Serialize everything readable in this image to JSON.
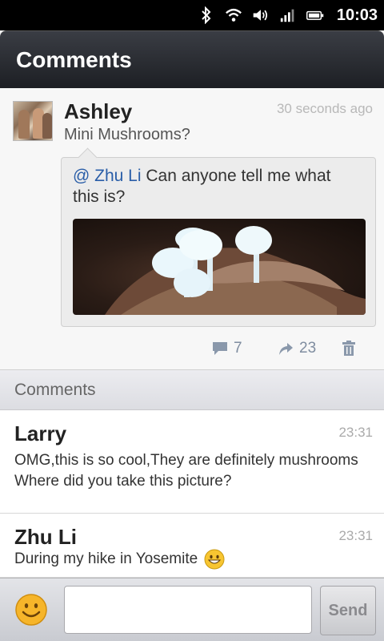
{
  "status_bar": {
    "time": "10:03",
    "icons": [
      "bluetooth-icon",
      "wifi-icon",
      "volume-icon",
      "signal-icon",
      "battery-icon"
    ]
  },
  "header": {
    "title": "Comments"
  },
  "post": {
    "author": "Ashley",
    "time_ago": "30 seconds ago",
    "subtitle": "Mini Mushrooms?",
    "quote": {
      "mention": "@ Zhu Li",
      "text": " Can anyone tell me what this is?"
    },
    "image_alt": "mushrooms-photo",
    "actions": {
      "comments_count": "7",
      "shares_count": "23"
    }
  },
  "comments_section": {
    "label": "Comments"
  },
  "comments": [
    {
      "author": "Larry",
      "time": "23:31",
      "text": "OMG,this is so cool,They are definitely mushrooms Where did you take this picture?"
    },
    {
      "author": "Zhu Li",
      "time": "23:31",
      "text": "During my hike in Yosemite"
    }
  ],
  "input_bar": {
    "placeholder": "",
    "send_label": "Send"
  },
  "colors": {
    "accent_link": "#2a5ea8",
    "title_bar": "#2a2c32"
  }
}
